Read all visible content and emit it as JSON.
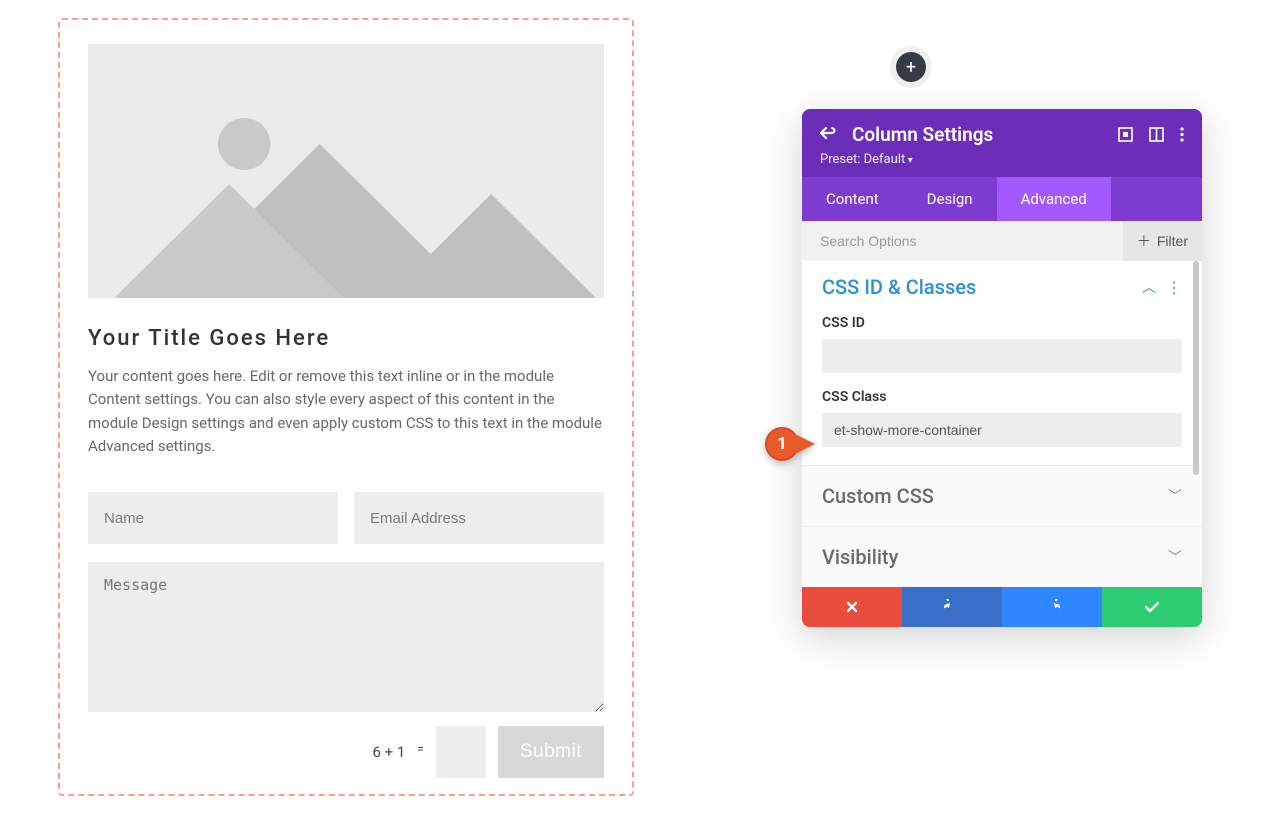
{
  "content": {
    "title": "Your Title Goes Here",
    "body": "Your content goes here. Edit or remove this text inline or in the module Content settings. You can also style every aspect of this content in the module Design settings and even apply custom CSS to this text in the module Advanced settings.",
    "form": {
      "name_placeholder": "Name",
      "email_placeholder": "Email Address",
      "message_placeholder": "Message",
      "captcha_expr": "6 + 1",
      "captcha_eq": "=",
      "submit_label": "Submit"
    }
  },
  "fab": {
    "icon": "+"
  },
  "panel": {
    "title": "Column Settings",
    "preset": "Preset: Default",
    "tabs": {
      "content": "Content",
      "design": "Design",
      "advanced": "Advanced",
      "active": "advanced"
    },
    "search_placeholder": "Search Options",
    "filter_label": "Filter",
    "sections": {
      "css": {
        "title": "CSS ID & Classes",
        "id_label": "CSS ID",
        "id_value": "",
        "class_label": "CSS Class",
        "class_value": "et-show-more-container"
      },
      "custom_css": {
        "title": "Custom CSS"
      },
      "visibility": {
        "title": "Visibility"
      }
    }
  },
  "callout": {
    "number": "1"
  }
}
